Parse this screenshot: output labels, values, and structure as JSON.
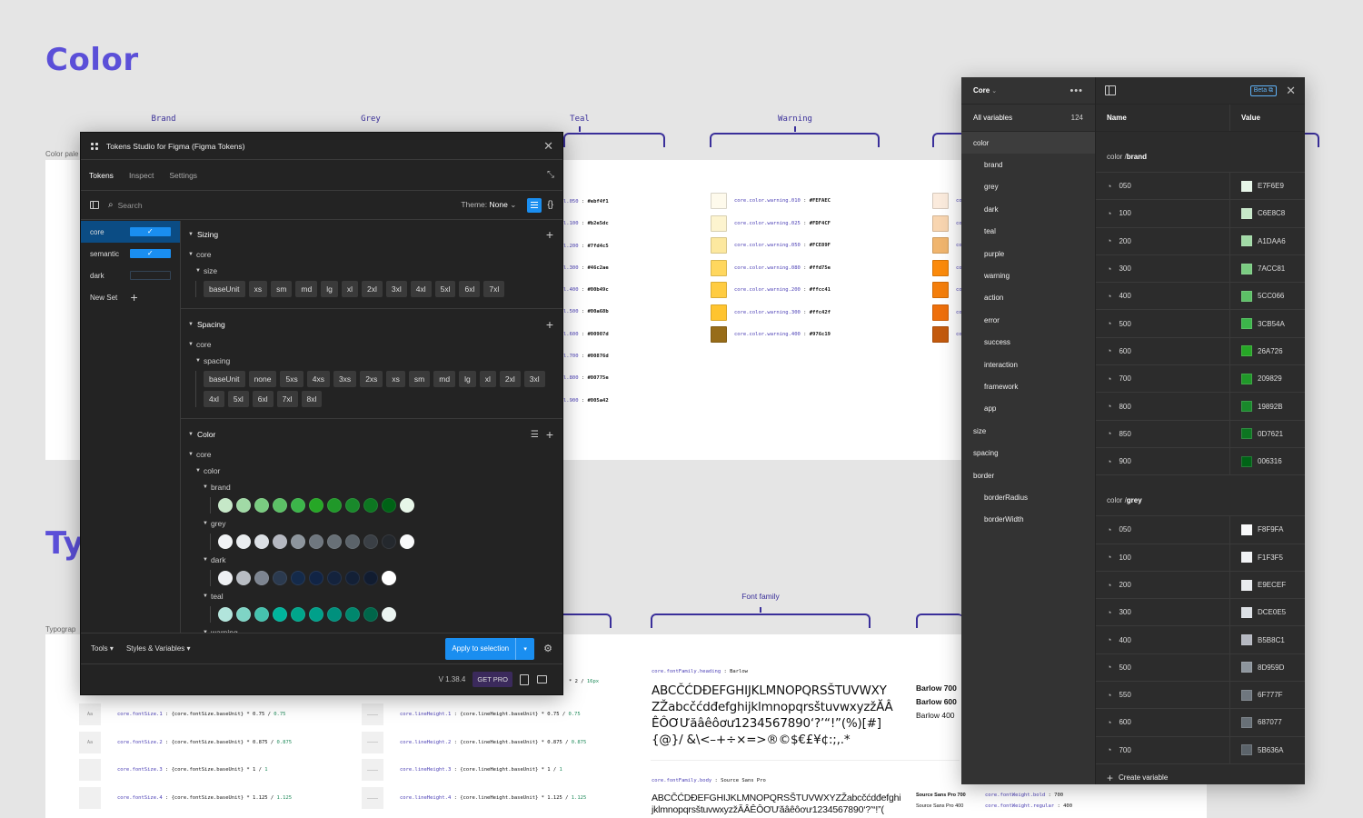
{
  "canvas": {
    "color_title": "Color",
    "typography_title_visible": "Ty",
    "color_palette_label": "Color pale",
    "typography_label": "Typograp",
    "brackets": [
      {
        "label": "Brand"
      },
      {
        "label": "Grey"
      },
      {
        "label": "Teal"
      },
      {
        "label": "Warning"
      }
    ],
    "font_family_bracket": "Font family",
    "teal_tokens": [
      {
        "key": "l.050",
        "value": "#ebf4f1"
      },
      {
        "key": "l.100",
        "value": "#b2e5dc"
      },
      {
        "key": "l.200",
        "value": "#7fd4c5"
      },
      {
        "key": "l.300",
        "value": "#46c2ae"
      },
      {
        "key": "l.400",
        "value": "#00b49c"
      },
      {
        "key": "l.500",
        "value": "#00a68b"
      },
      {
        "key": "l.600",
        "value": "#00907d"
      },
      {
        "key": "l.700",
        "value": "#00876d"
      },
      {
        "key": "l.800",
        "value": "#00775e"
      },
      {
        "key": "l.900",
        "value": "#005a42"
      }
    ],
    "warning_tokens": [
      {
        "key": "core.color.warning.010",
        "value": "#FEFAEC",
        "color": "#FEFAEC"
      },
      {
        "key": "core.color.warning.025",
        "value": "#FDF4CF",
        "color": "#FDF4CF"
      },
      {
        "key": "core.color.warning.050",
        "value": "#FCE89F",
        "color": "#FCE89F"
      },
      {
        "key": "core.color.warning.080",
        "value": "#ffd75e",
        "color": "#ffd75e"
      },
      {
        "key": "core.color.warning.200",
        "value": "#ffcc41",
        "color": "#ffcc41"
      },
      {
        "key": "core.color.warning.300",
        "value": "#ffc42f",
        "color": "#ffc42f"
      },
      {
        "key": "core.color.warning.400",
        "value": "#976c19",
        "color": "#976c19"
      }
    ],
    "orange_swatches": [
      "#FBEBDD",
      "#F8D5B0",
      "#F0B56E",
      "#FB8A0B",
      "#F47E0B",
      "#EE6F0B",
      "#C35A0E"
    ],
    "orange_key_prefix": "co",
    "font_size_tokens": [
      {
        "box": "Aa",
        "key": "core.fontSize.1",
        "expr": " : {core.fontSize.baseUnit} * 0.75 / ",
        "result": "0.75"
      },
      {
        "box": "Aa",
        "key": "core.fontSize.2",
        "expr": " : {core.fontSize.baseUnit} * 0.875 / ",
        "result": "0.875"
      },
      {
        "box": "",
        "key": "core.fontSize.3",
        "expr": " : {core.fontSize.baseUnit} * 1 / ",
        "result": "1"
      },
      {
        "box": "",
        "key": "core.fontSize.4",
        "expr": " : {core.fontSize.baseUnit} * 1.125 / ",
        "result": "1.125"
      }
    ],
    "line_height_tokens": [
      {
        "key": "core.lineHeight.1",
        "expr": " : {core.lineHeight.baseUnit} * 0.75 / ",
        "result": "0.75"
      },
      {
        "key": "core.lineHeight.2",
        "expr": " : {core.lineHeight.baseUnit} * 0.875 / ",
        "result": "0.875"
      },
      {
        "key": "core.lineHeight.3",
        "expr": " : {core.lineHeight.baseUnit} * 1 / ",
        "result": "1"
      },
      {
        "key": "core.lineHeight.4",
        "expr": " : {core.lineHeight.baseUnit} * 1.125 / ",
        "result": "1.125"
      }
    ],
    "partial_line_top": {
      "expr": " * 2 / ",
      "result": "16px"
    },
    "heading_font": {
      "key": "core.fontFamily.heading",
      "value": " : Barlow",
      "sample": "ABCČĆDĐEFGHIJKLMNOPQRSŠTUVWXY ZŽabcčćdđefghijklmnopqrsštuvwxyzžĂÂ ÊÔƠƯăâêôơư1234567890‘?’“!”(%)[#]{@}/ &\\<–+÷×=>®©$€£¥¢:;,.*",
      "weights": [
        "Barlow 700",
        "Barlow 600",
        "Barlow 400"
      ]
    },
    "body_font": {
      "key": "core.fontFamily.body",
      "value": " : Source Sans Pro",
      "sample": "ABCČĆDĐEFGHIJKLMNOPQRSŠTUVWXYZŽabcčćdđefghi jklmnopqrsštuvwxyzžĂÂÊÔƠƯăâêôơư1234567890‘?’“!”(",
      "weights": [
        "Source Sans Pro 700",
        "Source Sans Pro 400"
      ]
    },
    "font_weights": [
      {
        "key": "core.fontWeight.bold",
        "value": " : 700"
      },
      {
        "key": "core.fontWeight.regular",
        "value": " : 400"
      }
    ]
  },
  "plugin": {
    "title": "Tokens Studio for Figma (Figma Tokens)",
    "tabs": [
      {
        "label": "Tokens",
        "active": true
      },
      {
        "label": "Inspect",
        "active": false
      },
      {
        "label": "Settings",
        "active": false
      }
    ],
    "search_placeholder": "Search",
    "theme_label": "Theme: ",
    "theme_value": "None",
    "sets": [
      {
        "label": "core",
        "checked": true,
        "active": true
      },
      {
        "label": "semantic",
        "checked": true,
        "active": false
      },
      {
        "label": "dark",
        "checked": false,
        "active": false
      }
    ],
    "new_set_label": "New Set",
    "sizing": {
      "title": "Sizing",
      "group": "core",
      "subgroup": "size",
      "tokens": [
        "baseUnit",
        "xs",
        "sm",
        "md",
        "lg",
        "xl",
        "2xl",
        "3xl",
        "4xl",
        "5xl",
        "6xl",
        "7xl"
      ]
    },
    "spacing": {
      "title": "Spacing",
      "group": "core",
      "subgroup": "spacing",
      "tokens": [
        "baseUnit",
        "none",
        "5xs",
        "4xs",
        "3xs",
        "2xs",
        "xs",
        "sm",
        "md",
        "lg",
        "xl",
        "2xl",
        "3xl",
        "4xl",
        "5xl",
        "6xl",
        "7xl",
        "8xl"
      ]
    },
    "color": {
      "title": "Color",
      "group": "core",
      "subgroup": "color",
      "palettes": [
        {
          "name": "brand",
          "colors": [
            "#C6E8C8",
            "#A1DAA6",
            "#7ACC81",
            "#5CC066",
            "#3CB54A",
            "#26A726",
            "#209829",
            "#19892B",
            "#0D7621",
            "#006316",
            "#E7F6E9"
          ]
        },
        {
          "name": "grey",
          "colors": [
            "#F1F3F5",
            "#E9ECEF",
            "#DCE0E5",
            "#B5B8C1",
            "#8D959D",
            "#6F777F",
            "#687077",
            "#5B636A",
            "#3A3F45",
            "#24282D",
            "#F8F9FA"
          ]
        },
        {
          "name": "dark",
          "colors": [
            "#EEF0F3",
            "#B8BCC3",
            "#7D8591",
            "#2B3A4F",
            "#142A4A",
            "#112445",
            "#14233D",
            "#132036",
            "#111C30",
            "#FFFFFF"
          ]
        },
        {
          "name": "teal",
          "colors": [
            "#B2E5DC",
            "#7FD4C5",
            "#46C2AE",
            "#00B49C",
            "#00A68B",
            "#00A08A",
            "#00907D",
            "#00876D",
            "#00664A",
            "#EBF4F1"
          ]
        },
        {
          "name": "warning",
          "colors": []
        }
      ]
    },
    "footer": {
      "tools": "Tools",
      "styles_vars": "Styles & Variables",
      "apply": "Apply to selection",
      "version": "V 1.38.4",
      "get_pro": "GET PRO"
    }
  },
  "variables": {
    "collection": "Core",
    "all_variables_label": "All variables",
    "count": "124",
    "beta_label": "Beta",
    "col_name": "Name",
    "col_value": "Value",
    "groups": [
      {
        "label": "color",
        "level": 0,
        "active": true
      },
      {
        "label": "brand",
        "level": 1
      },
      {
        "label": "grey",
        "level": 1
      },
      {
        "label": "dark",
        "level": 1
      },
      {
        "label": "teal",
        "level": 1
      },
      {
        "label": "purple",
        "level": 1
      },
      {
        "label": "warning",
        "level": 1
      },
      {
        "label": "action",
        "level": 1
      },
      {
        "label": "error",
        "level": 1
      },
      {
        "label": "success",
        "level": 1
      },
      {
        "label": "interaction",
        "level": 1
      },
      {
        "label": "framework",
        "level": 1
      },
      {
        "label": "app",
        "level": 1
      },
      {
        "label": "size",
        "level": 0
      },
      {
        "label": "spacing",
        "level": 0
      },
      {
        "label": "border",
        "level": 0
      },
      {
        "label": "borderRadius",
        "level": 1
      },
      {
        "label": "borderWidth",
        "level": 1
      }
    ],
    "sections": [
      {
        "prefix": "color / ",
        "name": "brand",
        "rows": [
          {
            "name": "050",
            "value": "E7F6E9"
          },
          {
            "name": "100",
            "value": "C6E8C8"
          },
          {
            "name": "200",
            "value": "A1DAA6"
          },
          {
            "name": "300",
            "value": "7ACC81"
          },
          {
            "name": "400",
            "value": "5CC066"
          },
          {
            "name": "500",
            "value": "3CB54A"
          },
          {
            "name": "600",
            "value": "26A726"
          },
          {
            "name": "700",
            "value": "209829"
          },
          {
            "name": "800",
            "value": "19892B"
          },
          {
            "name": "850",
            "value": "0D7621"
          },
          {
            "name": "900",
            "value": "006316"
          }
        ]
      },
      {
        "prefix": "color / ",
        "name": "grey",
        "rows": [
          {
            "name": "050",
            "value": "F8F9FA"
          },
          {
            "name": "100",
            "value": "F1F3F5"
          },
          {
            "name": "200",
            "value": "E9ECEF"
          },
          {
            "name": "300",
            "value": "DCE0E5"
          },
          {
            "name": "400",
            "value": "B5B8C1"
          },
          {
            "name": "500",
            "value": "8D959D"
          },
          {
            "name": "550",
            "value": "6F777F"
          },
          {
            "name": "600",
            "value": "687077"
          },
          {
            "name": "700",
            "value": "5B636A"
          }
        ]
      }
    ],
    "create_label": "Create variable"
  }
}
